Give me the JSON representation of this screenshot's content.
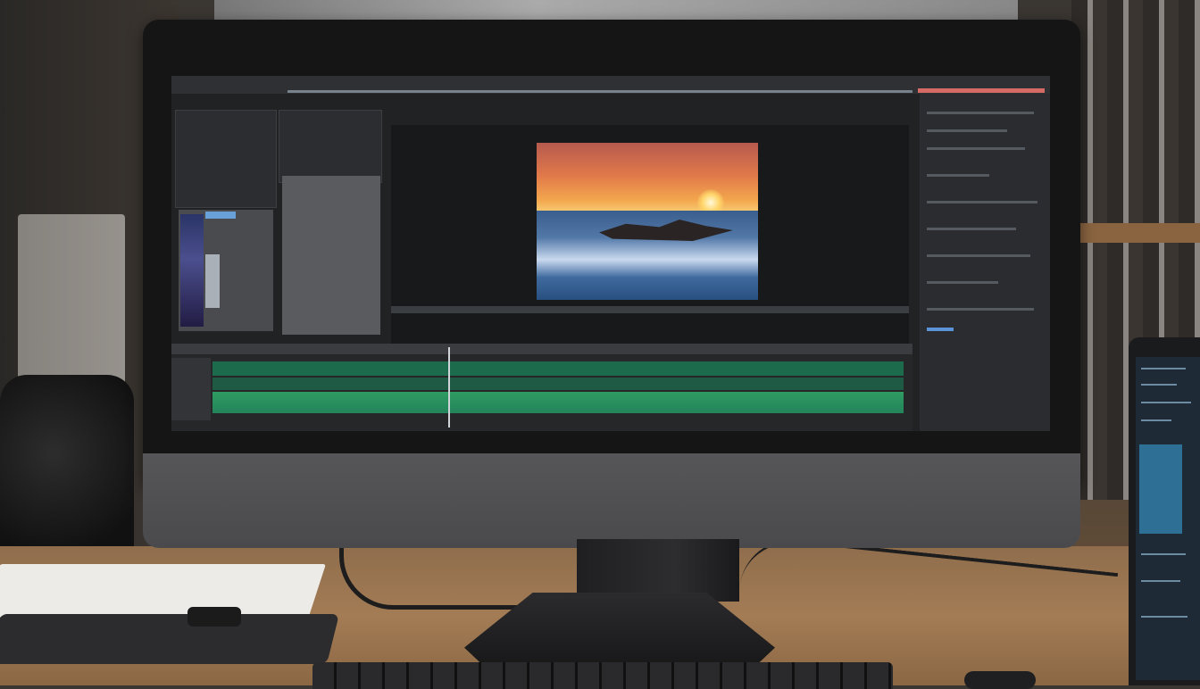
{
  "scene": {
    "description_colors": {
      "desk": "#a37c55",
      "monitor_bezel": "#151516",
      "monitor_chin": "#565659",
      "timeline_track": "#2f9c62",
      "accent_bar": "#d66a65"
    },
    "icons": [
      "apple-logo-icon"
    ]
  },
  "monitor": {
    "logo_glyph": ""
  }
}
